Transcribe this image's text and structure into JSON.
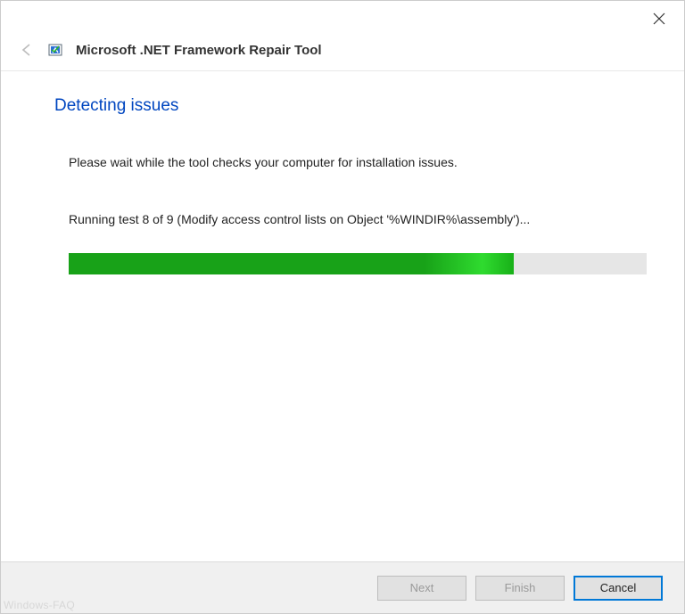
{
  "window": {
    "title": "Microsoft .NET Framework Repair Tool"
  },
  "page": {
    "heading": "Detecting issues",
    "instruction": "Please wait while the tool checks your computer for installation issues.",
    "status": "Running test 8 of 9 (Modify access control lists on Object '%WINDIR%\\assembly')...",
    "progress_percent": 77
  },
  "buttons": {
    "next": "Next",
    "finish": "Finish",
    "cancel": "Cancel"
  },
  "watermark": "Windows-FAQ"
}
